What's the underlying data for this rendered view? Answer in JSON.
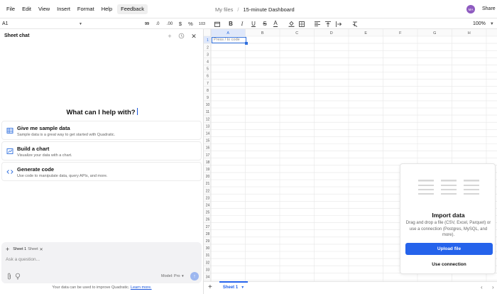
{
  "menubar": {
    "menus": [
      "File",
      "Edit",
      "View",
      "Insert",
      "Format",
      "Help",
      "Feedback"
    ],
    "breadcrumb_parent": "My files",
    "breadcrumb_separator": "/",
    "file_name": "15-minute Dashboard",
    "avatar_initials": "MA",
    "share_label": "Share"
  },
  "toolbar": {
    "cell_ref": "A1",
    "format_labels": {
      "decimals_decrease": ".0",
      "decimals_increase": ".00",
      "currency": "$",
      "percent": "%",
      "scientific": "103"
    },
    "zoom": "100%"
  },
  "grid": {
    "columns": [
      "A",
      "B",
      "C",
      "D",
      "E",
      "F",
      "G",
      "H"
    ],
    "rows": [
      "1",
      "2",
      "3",
      "4",
      "5",
      "6",
      "7",
      "8",
      "9",
      "10",
      "11",
      "12",
      "13",
      "14",
      "15",
      "16",
      "17",
      "18",
      "19",
      "20",
      "21",
      "22",
      "23",
      "24",
      "25",
      "26",
      "27",
      "28",
      "29",
      "30",
      "31",
      "32",
      "33",
      "34"
    ],
    "active_cell_placeholder": "Press / to code"
  },
  "panel": {
    "title": "Sheet chat",
    "greeting": "What can I help with?",
    "suggestions": [
      {
        "title": "Give me sample data",
        "desc": "Sample data is a great way to get started with Quadratic.",
        "icon": "table-icon"
      },
      {
        "title": "Build a chart",
        "desc": "Visualize your data with a chart.",
        "icon": "chart-icon"
      },
      {
        "title": "Generate code",
        "desc": "Use code to manipulate data, query APIs, and more.",
        "icon": "code-icon"
      }
    ],
    "context_chip": "Sheet 1",
    "context_chip_sub": "Sheet",
    "ask_placeholder": "Ask a question...",
    "model_label": "Model: Pro",
    "notice_text": "Your data can be used to improve Quadratic.",
    "notice_link": "Learn more."
  },
  "import_card": {
    "title": "Import data",
    "description": "Drag and drop a file (CSV, Excel, Parquet) or use a connection (Postgres, MySQL, and more).",
    "upload_label": "Upload file",
    "connection_label": "Use connection"
  },
  "sheetbar": {
    "add_label": "+",
    "tab_label": "Sheet 1"
  },
  "colors": {
    "accent": "#2563eb",
    "avatar": "#8e5bc0",
    "selection": "#2f6fde"
  }
}
